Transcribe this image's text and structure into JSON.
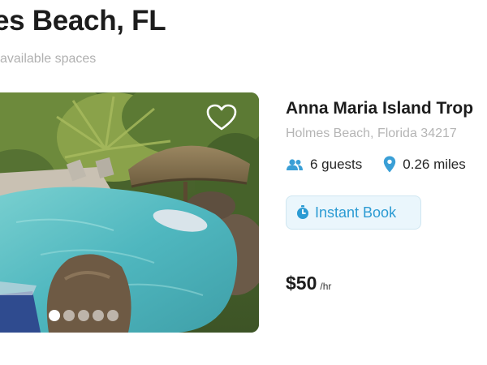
{
  "header": {
    "title": "es Beach, FL",
    "results_count": "available spaces"
  },
  "listing": {
    "title": "Anna Maria Island Trop",
    "address": "Holmes Beach, Florida 34217",
    "guests": "6 guests",
    "distance": "0.26 miles",
    "instant_book_label": "Instant Book",
    "price": "$50",
    "price_unit": "/hr",
    "photo_dots": 5,
    "active_dot": 0
  },
  "colors": {
    "accent": "#2b9bd3",
    "instant_book_bg": "#eaf6fc"
  },
  "icons": {
    "favorite": "heart-outline-icon",
    "guests": "users-icon",
    "distance": "map-pin-icon",
    "instant_book": "stopwatch-icon"
  }
}
